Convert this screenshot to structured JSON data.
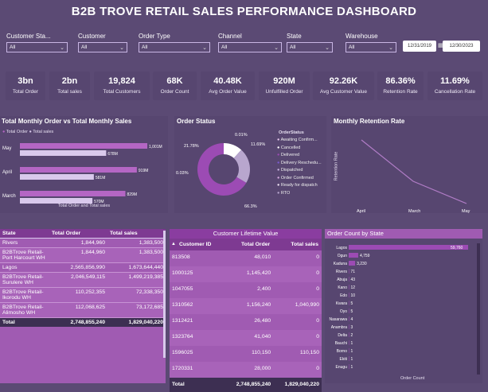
{
  "title": "B2B TROVE RETAIL SALES PERFORMANCE DASHBOARD",
  "slicers": [
    {
      "label": "Customer Sta...",
      "value": "All"
    },
    {
      "label": "Customer",
      "value": "All"
    },
    {
      "label": "Order Type",
      "value": "All"
    },
    {
      "label": "Channel",
      "value": "All"
    },
    {
      "label": "State",
      "value": "All"
    },
    {
      "label": "Warehouse",
      "value": "All"
    }
  ],
  "dates": {
    "start": "12/31/2019",
    "end": "12/30/2023"
  },
  "kpis": [
    {
      "value": "3bn",
      "label": "Total Order"
    },
    {
      "value": "2bn",
      "label": "Total sales"
    },
    {
      "value": "19,824",
      "label": "Total Customers"
    },
    {
      "value": "68K",
      "label": "Order Count"
    },
    {
      "value": "40.48K",
      "label": "Avg Order Value"
    },
    {
      "value": "920M",
      "label": "Unfulfilled Order"
    },
    {
      "value": "92.26K",
      "label": "Avg Customer Value"
    },
    {
      "value": "86.36%",
      "label": "Retention Rate"
    },
    {
      "value": "11.69%",
      "label": "Cancellation Rate"
    }
  ],
  "monthly_chart": {
    "title": "Total Monthly Order vs Total Monthly Sales",
    "legend": [
      "Total Order",
      "Total sales"
    ],
    "xlabel": "Total Order and Total sales",
    "colors": {
      "order": "#b466c4",
      "sales": "#d9c9ec"
    }
  },
  "status_chart": {
    "title": "Order Status",
    "legend_title": "OrderStatus",
    "legend": [
      "Awaiting Confirm...",
      "Cancelled",
      "Delivered",
      "Delivery Reschedu...",
      "Dispatched",
      "Order Confirmed",
      "Ready for dispatch",
      "RTO"
    ],
    "labels": [
      "0.01%",
      "11.69%",
      "21.78%",
      "0.03%",
      "66.3%"
    ]
  },
  "retention_chart": {
    "title": "Monthly Retention Rate",
    "ylabel": "Retention Rate"
  },
  "state_table": {
    "headers": [
      "State",
      "Total Order",
      "Total sales"
    ],
    "rows": [
      {
        "name": "Rivers",
        "order": "1,844,960",
        "sales": "1,383,500",
        "type": "state"
      },
      {
        "name": "B2BTrove Retail-Port Harcourt WH",
        "order": "1,844,960",
        "sales": "1,383,500",
        "type": "wh"
      },
      {
        "name": "Lagos",
        "order": "2,565,856,990",
        "sales": "1,673,644,440",
        "type": "state"
      },
      {
        "name": "B2BTrove Retail-Surulere WH",
        "order": "2,046,549,115",
        "sales": "1,499,219,385",
        "type": "wh"
      },
      {
        "name": "B2BTrove Retail-Ikorodu WH",
        "order": "110,252,355",
        "sales": "72,338,350",
        "type": "wh"
      },
      {
        "name": "B2BTrove Retail-Alimosho WH",
        "order": "112,068,625",
        "sales": "73,172,685",
        "type": "wh"
      }
    ],
    "total": {
      "name": "Total",
      "order": "2,748,855,240",
      "sales": "1,829,040,220"
    }
  },
  "clv_table": {
    "title": "Customer Lifetime Value",
    "headers": [
      "Customer ID",
      "Total Order",
      "Total sales"
    ],
    "rows": [
      [
        "813508",
        "48,010",
        "0"
      ],
      [
        "1000125",
        "1,145,420",
        "0"
      ],
      [
        "1047055",
        "2,400",
        "0"
      ],
      [
        "1310562",
        "1,156,240",
        "1,040,990"
      ],
      [
        "1312421",
        "26,480",
        "0"
      ],
      [
        "1323764",
        "41,040",
        "0"
      ],
      [
        "1596025",
        "110,150",
        "110,150"
      ],
      [
        "1720331",
        "28,000",
        "0"
      ]
    ],
    "total": [
      "Total",
      "2,748,855,240",
      "1,829,040,220"
    ]
  },
  "state_count_chart": {
    "title": "Order Count by State",
    "xlabel": "Order Count"
  },
  "chart_data": [
    {
      "type": "bar",
      "title": "Total Monthly Order vs Total Monthly Sales",
      "categories": [
        "May",
        "April",
        "March"
      ],
      "series": [
        {
          "name": "Total Order",
          "values": [
            1001,
            919,
            829
          ],
          "labels": [
            "1,001M",
            "919M",
            "829M"
          ]
        },
        {
          "name": "Total sales",
          "values": [
            678,
            581,
            570
          ],
          "labels": [
            "678M",
            "581M",
            "570M"
          ]
        }
      ],
      "xlabel": "Total Order and Total sales"
    },
    {
      "type": "pie",
      "title": "Order Status",
      "categories": [
        "Delivered",
        "Cancelled",
        "RTO",
        "Awaiting Confirm...",
        "Delivery Reschedu..."
      ],
      "values": [
        66.3,
        11.69,
        21.78,
        0.01,
        0.03
      ],
      "colors": [
        "#9c4bb4",
        "#ffffff",
        "#b8a6ce",
        "#e8c8ee",
        "#7a5ad0"
      ]
    },
    {
      "type": "line",
      "title": "Monthly Retention Rate",
      "categories": [
        "April",
        "March",
        "May"
      ],
      "values": [
        98,
        90,
        76
      ],
      "ylabel": "Retention Rate"
    },
    {
      "type": "bar",
      "title": "Order Count by State",
      "categories": [
        "Lagos",
        "Ogun",
        "Kaduna",
        "Rivers",
        "Abuja",
        "Kano",
        "Edo",
        "Kwara",
        "Oyo",
        "Nasarawa",
        "Anambra",
        "Delta",
        "Bauchi",
        "Borno",
        "Ekiti",
        "Enugu"
      ],
      "values": [
        59760,
        4759,
        3230,
        71,
        43,
        12,
        10,
        5,
        5,
        4,
        3,
        2,
        1,
        1,
        1,
        1
      ],
      "labels": [
        "59,760",
        "4,759",
        "3,230",
        "71",
        "43",
        "12",
        "10",
        "5",
        "5",
        "4",
        "3",
        "2",
        "1",
        "1",
        "1",
        "1"
      ],
      "xlabel": "Order Count"
    }
  ]
}
